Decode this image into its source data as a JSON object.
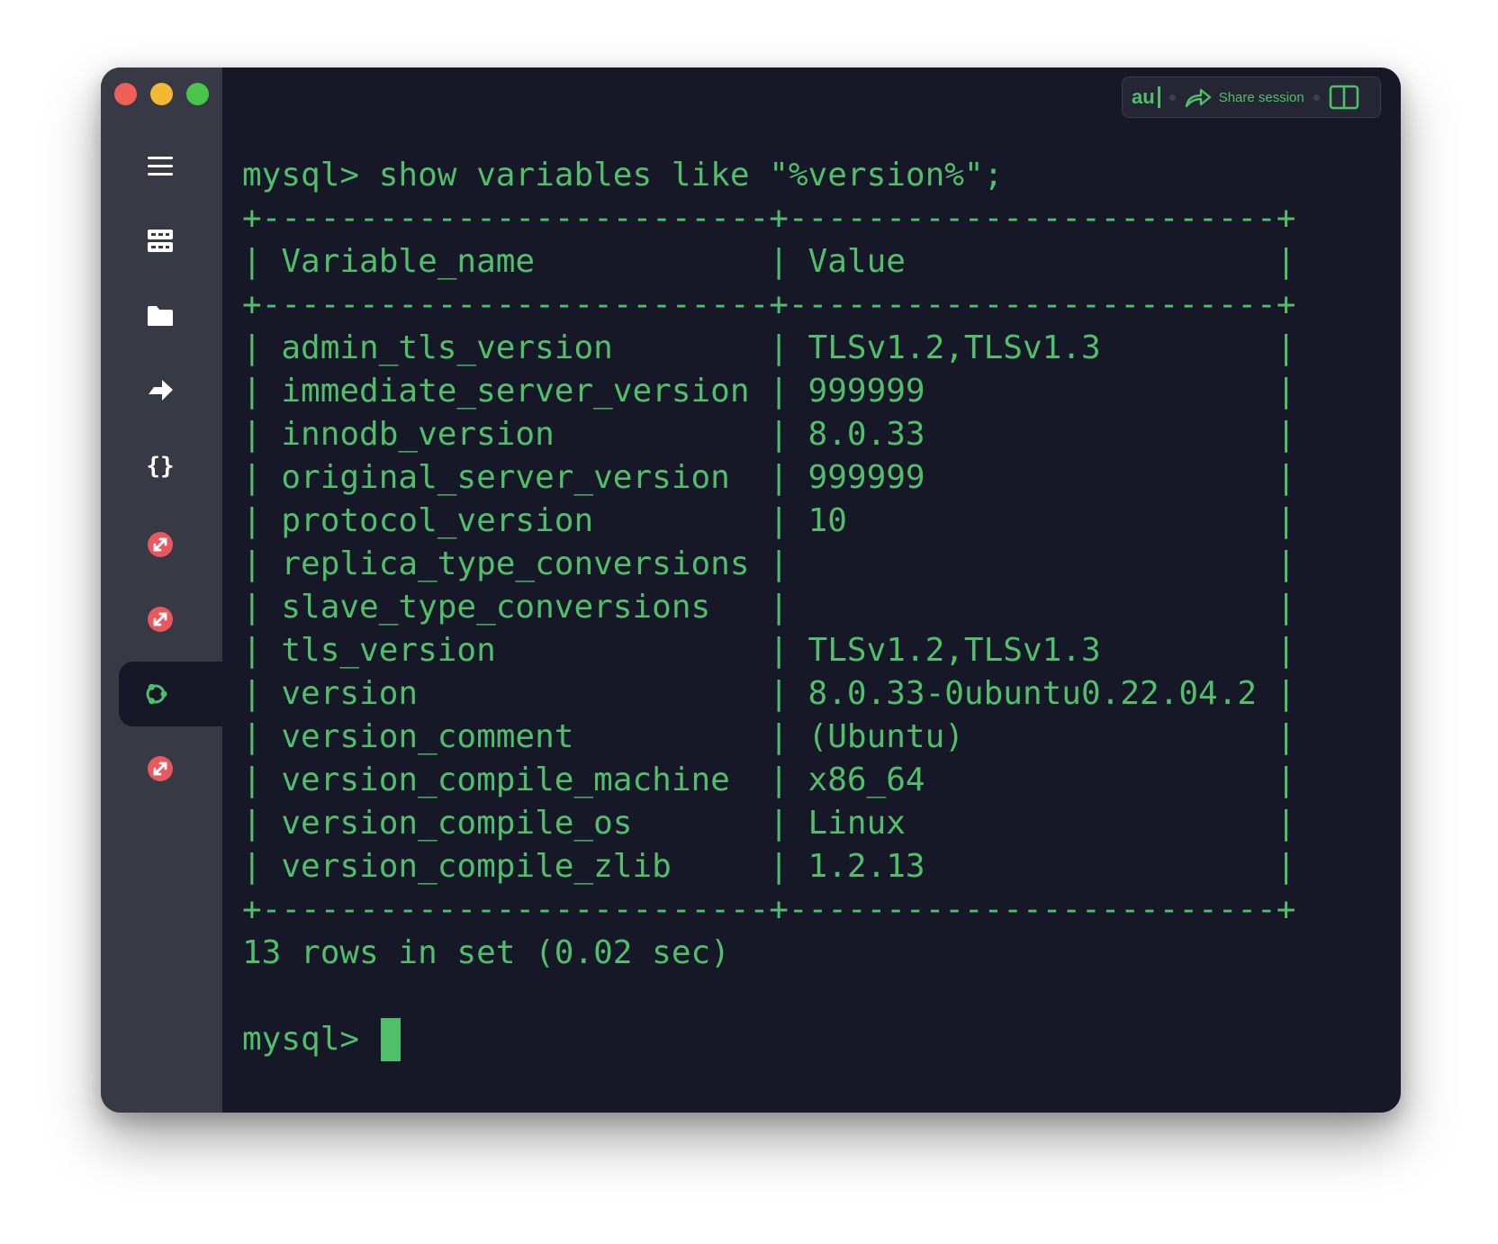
{
  "toolbar": {
    "ai_label": "au",
    "share_label": "Share session"
  },
  "terminal": {
    "command_line": "mysql> show variables like \"%version%\";",
    "table": {
      "headers": [
        "Variable_name",
        "Value"
      ],
      "rows": [
        [
          "admin_tls_version",
          "TLSv1.2,TLSv1.3"
        ],
        [
          "immediate_server_version",
          "999999"
        ],
        [
          "innodb_version",
          "8.0.33"
        ],
        [
          "original_server_version",
          "999999"
        ],
        [
          "protocol_version",
          "10"
        ],
        [
          "replica_type_conversions",
          ""
        ],
        [
          "slave_type_conversions",
          ""
        ],
        [
          "tls_version",
          "TLSv1.2,TLSv1.3"
        ],
        [
          "version",
          "8.0.33-0ubuntu0.22.04.2"
        ],
        [
          "version_comment",
          "(Ubuntu)"
        ],
        [
          "version_compile_machine",
          "x86_64"
        ],
        [
          "version_compile_os",
          "Linux"
        ],
        [
          "version_compile_zlib",
          "1.2.13"
        ]
      ]
    },
    "result_summary": "13 rows in set (0.02 sec)",
    "prompt": "mysql>"
  },
  "icons": {
    "sidebar": [
      "menu-icon",
      "hosts-icon",
      "folder-icon",
      "forward-icon",
      "snippets-icon",
      "connection-icon",
      "connection-icon",
      "ubuntu-icon",
      "connection-icon"
    ],
    "toolbar": [
      "share-icon",
      "split-view-icon"
    ]
  },
  "colors": {
    "text": "#4fbf6a",
    "background": "#161828",
    "sidebar": "#373945",
    "connection": "#e8585c"
  }
}
